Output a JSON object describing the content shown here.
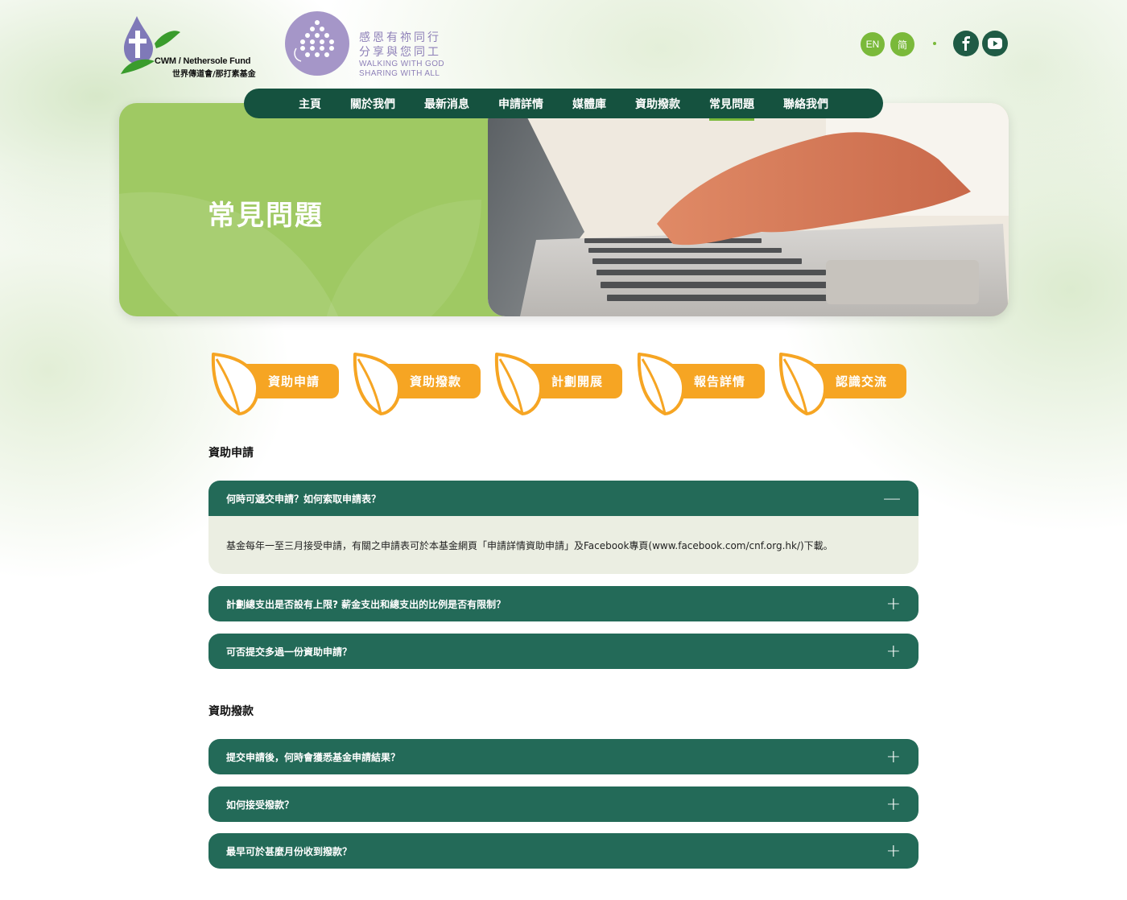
{
  "header": {
    "logo_cwm_text": "CWM / Nethersole Fund",
    "logo_cwm_zh": "世界傳道會/那打素基金",
    "logo2_line1": "感恩有祢同行",
    "logo2_line2": "分享與您同工",
    "logo2_en1": "WALKING WITH GOD",
    "logo2_en2": "SHARING WITH ALL",
    "lang_en": "EN",
    "lang_sc": "简"
  },
  "nav": {
    "items": [
      "主頁",
      "關於我們",
      "最新消息",
      "申請詳情",
      "媒體庫",
      "資助撥款",
      "常見問題",
      "聯絡我們"
    ],
    "active_index": 6
  },
  "banner": {
    "title": "常見問題"
  },
  "categories": [
    "資助申請",
    "資助撥款",
    "計劃開展",
    "報告詳情",
    "認識交流"
  ],
  "sections": [
    {
      "heading": "資助申請",
      "questions": [
        {
          "q": "何時可遞交申請？如何索取申請表？",
          "open": true,
          "answer": "基金每年一至三月接受申請，有關之申請表可於本基金網頁「申請詳情資助申請」及Facebook專頁(www.facebook.com/cnf.org.hk/)下載。"
        },
        {
          "q": "計劃總支出是否設有上限? 薪金支出和總支出的比例是否有限制？",
          "open": false
        },
        {
          "q": "可否提交多過一份資助申請？",
          "open": false
        }
      ]
    },
    {
      "heading": "資助撥款",
      "questions": [
        {
          "q": "提交申請後，何時會獲悉基金申請結果？",
          "open": false
        },
        {
          "q": "如何接受撥款？",
          "open": false
        },
        {
          "q": "最早可於甚麼月份收到撥款？",
          "open": false
        }
      ]
    }
  ],
  "signs": {
    "open": "—",
    "closed": "+"
  },
  "colors": {
    "nav_bg": "#15523f",
    "accordion_bg": "#236a58",
    "accent_green": "#7ab93a",
    "pill_orange": "#f6a523",
    "banner_green": "#9fc963",
    "answer_bg": "#ebeee2"
  }
}
